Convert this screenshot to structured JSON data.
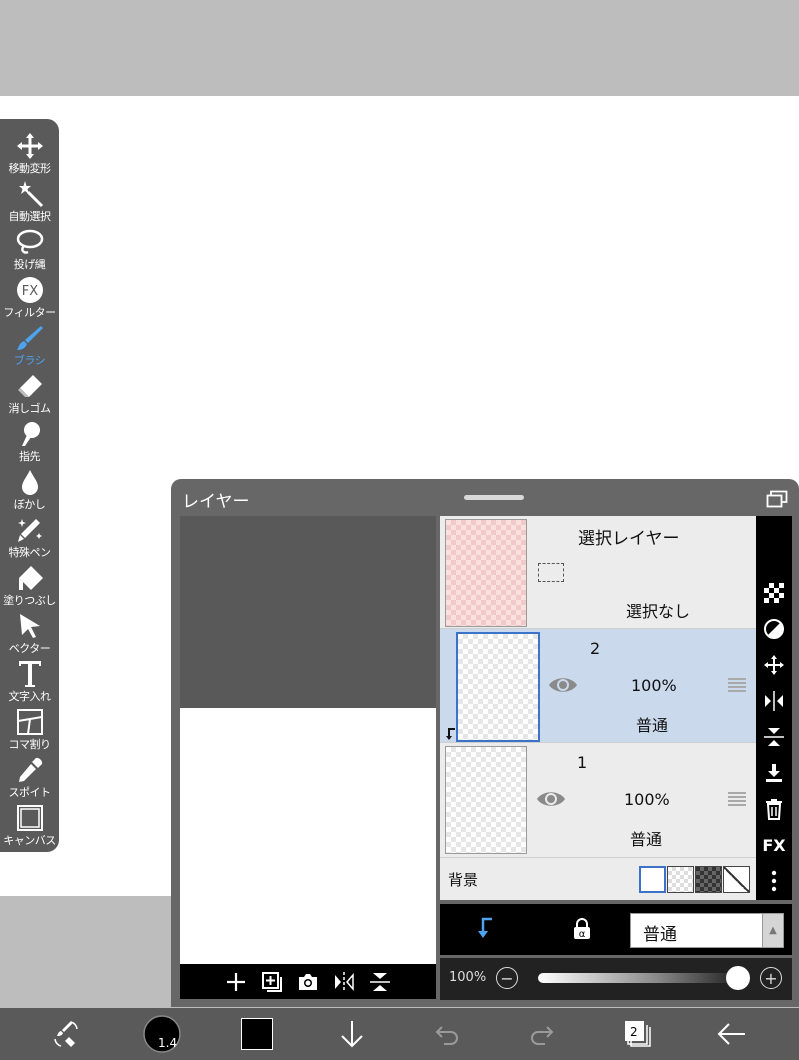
{
  "toolbar": {
    "tools": [
      {
        "label": "移動変形",
        "icon": "move-icon"
      },
      {
        "label": "自動選択",
        "icon": "magic-wand-icon"
      },
      {
        "label": "投げ縄",
        "icon": "lasso-icon"
      },
      {
        "label": "フィルター",
        "icon": "fx-icon"
      },
      {
        "label": "ブラシ",
        "icon": "brush-icon"
      },
      {
        "label": "消しゴム",
        "icon": "eraser-icon"
      },
      {
        "label": "指先",
        "icon": "finger-icon"
      },
      {
        "label": "ぼかし",
        "icon": "blur-icon"
      },
      {
        "label": "特殊ペン",
        "icon": "special-pen-icon"
      },
      {
        "label": "塗りつぶし",
        "icon": "fill-icon"
      },
      {
        "label": "ベクター",
        "icon": "vector-icon"
      },
      {
        "label": "文字入れ",
        "icon": "text-icon"
      },
      {
        "label": "コマ割り",
        "icon": "frame-divider-icon"
      },
      {
        "label": "スポイト",
        "icon": "eyedropper-icon"
      },
      {
        "label": "キャンバス",
        "icon": "canvas-icon"
      }
    ],
    "active_tool": "ブラシ",
    "active_color": "#4ea3f0"
  },
  "layer_panel": {
    "title": "レイヤー",
    "selection_layer": {
      "name": "選択レイヤー",
      "status": "選択なし"
    },
    "layers": [
      {
        "name": "2",
        "opacity": "100%",
        "blend": "普通",
        "selected": true,
        "clipped": true
      },
      {
        "name": "1",
        "opacity": "100%",
        "blend": "普通",
        "selected": false,
        "clipped": false
      }
    ],
    "background": {
      "label": "背景",
      "swatches": [
        "white",
        "transparent",
        "dark-checker",
        "none"
      ]
    },
    "right_tools": {
      "fx_label": "FX"
    },
    "blend_mode": "普通",
    "opacity": {
      "label": "100%",
      "value": 100
    }
  },
  "bottom": {
    "brush_size": "1.4",
    "layer_count": "2",
    "current_color": "#000000"
  },
  "colors": {
    "selected_row": "#cbd9ec",
    "accent_blue": "#4ea3f0"
  }
}
